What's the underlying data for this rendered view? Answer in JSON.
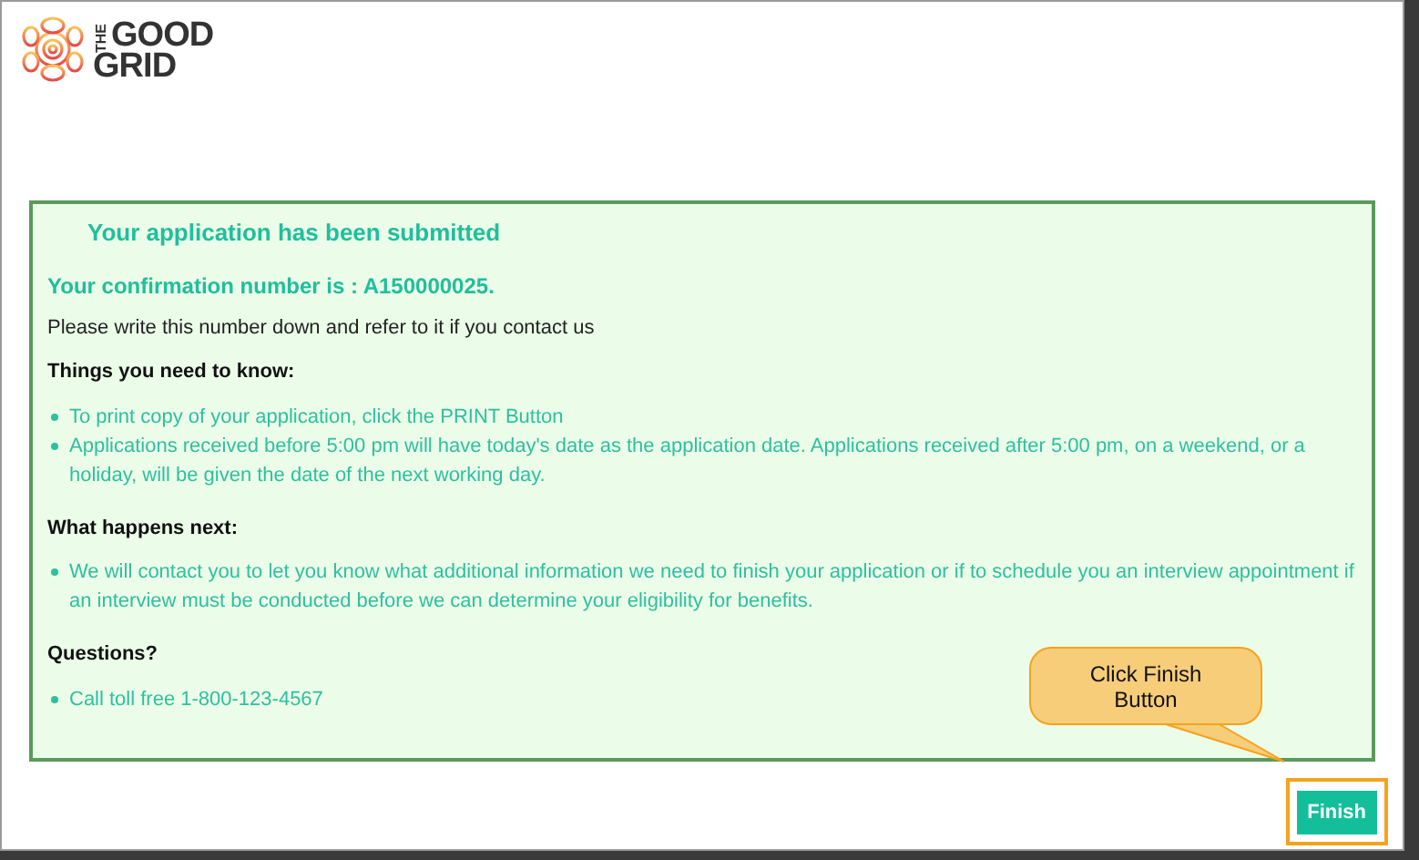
{
  "logo": {
    "small": "THE",
    "line1": "GOOD",
    "line2": "GRID"
  },
  "panel": {
    "title": "Your application has been submitted",
    "confirmation": "Your confirmation number is : A150000025.",
    "note": "Please write this number down and refer to it if you contact us",
    "sections": [
      {
        "heading": "Things you need to know:",
        "items": [
          "To print copy of your application, click the PRINT Button",
          "Applications received before 5:00 pm will have today's date as the application date. Applications received after 5:00 pm, on a weekend, or a holiday, will be given the date of the next working day."
        ]
      },
      {
        "heading": "What happens next:",
        "items": [
          "We will contact you to let you know what additional information we need to finish your application or if to schedule you an interview appointment if an interview must be conducted before we can determine your eligibility for benefits."
        ]
      },
      {
        "heading": "Questions?",
        "items": [
          "Call toll free 1-800-123-4567"
        ]
      }
    ]
  },
  "callout": "Click Finish Button",
  "finish_button": "Finish"
}
